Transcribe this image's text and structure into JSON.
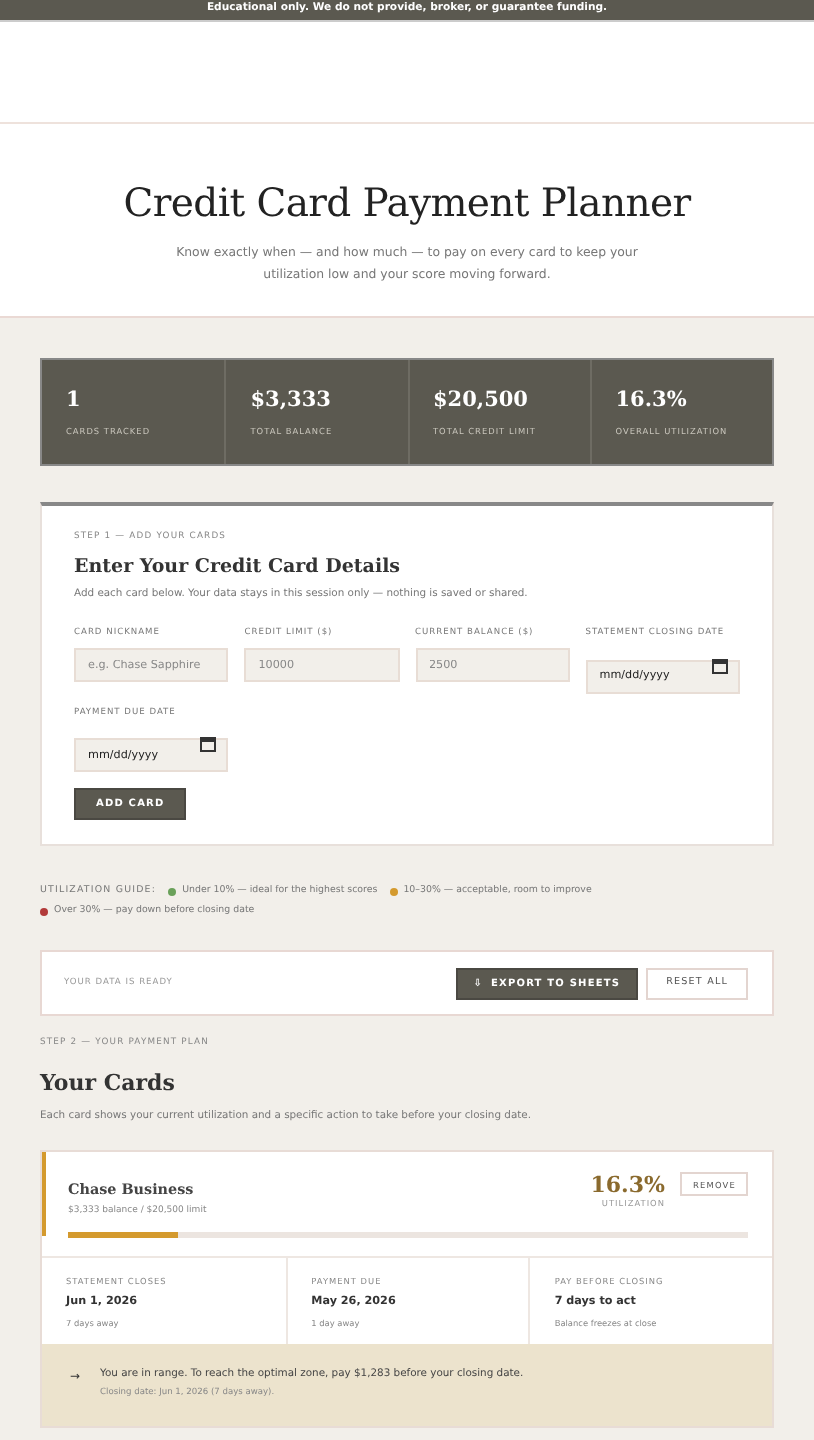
{
  "banner": "Educational only. We do not provide, broker, or guarantee funding.",
  "hero": {
    "title": "Credit Card Payment Planner",
    "subtitle": "Know exactly when — and how much — to pay on every card to keep your utilization low and your score moving forward."
  },
  "stats": [
    {
      "value": "1",
      "label": "CARDS TRACKED"
    },
    {
      "value": "$3,333",
      "label": "TOTAL BALANCE"
    },
    {
      "value": "$20,500",
      "label": "TOTAL CREDIT LIMIT"
    },
    {
      "value": "16.3%",
      "label": "OVERALL UTILIZATION"
    }
  ],
  "form": {
    "step": "STEP 1 — ADD YOUR CARDS",
    "title": "Enter Your Credit Card Details",
    "description": "Add each card below. Your data stays in this session only — nothing is saved or shared.",
    "fields": [
      {
        "kind": "text",
        "label": "CARD NICKNAME",
        "placeholder": "e.g. Chase Sapphire"
      },
      {
        "kind": "text",
        "label": "CREDIT LIMIT ($)",
        "placeholder": "10000"
      },
      {
        "kind": "text",
        "label": "CURRENT BALANCE ($)",
        "placeholder": "2500"
      },
      {
        "kind": "date",
        "label": "STATEMENT CLOSING DATE",
        "placeholder": "mm/dd/yyyy"
      },
      {
        "kind": "date",
        "label": "PAYMENT DUE DATE",
        "placeholder": "mm/dd/yyyy"
      }
    ],
    "button": "ADD CARD"
  },
  "guide": {
    "label": "UTILIZATION GUIDE:",
    "items": [
      {
        "text": "Under 10% — ideal for the highest scores",
        "color": "#6aa15a"
      },
      {
        "text": "10–30% — acceptable, room to improve",
        "color": "#d49a2e"
      },
      {
        "text": "Over 30% — pay down before closing date",
        "color": "#b23a3a"
      }
    ]
  },
  "export_bar": {
    "status": "YOUR DATA IS READY",
    "export_icon": "⇩",
    "export_button": "EXPORT TO SHEETS",
    "reset_button": "RESET ALL"
  },
  "plan": {
    "step": "STEP 2 — YOUR PAYMENT PLAN",
    "title": "Your Cards",
    "description": "Each card shows your current utilization and a specific action to take before your closing date."
  },
  "cards": [
    {
      "name": "Chase Business",
      "summary": "$3,333 balance  /  $20,500 limit",
      "utilization": "16.3%",
      "utilization_label": "UTILIZATION",
      "level": 0.163,
      "color": "#d49a2e",
      "remove": "REMOVE",
      "details": [
        {
          "label": "STATEMENT CLOSES",
          "value": "Jun 1, 2026",
          "note": "7 days away"
        },
        {
          "label": "PAYMENT DUE",
          "value": "May 26, 2026",
          "note": "1 day away"
        },
        {
          "label": "PAY BEFORE CLOSING",
          "value": "7 days to act",
          "note": "Balance freezes at close"
        }
      ],
      "advice_icon": "→",
      "advice": "You are in range. To reach the optimal zone, pay $1,283 before your closing date.",
      "advice_note": "Closing date: Jun 1, 2026 (7 days away)."
    }
  ]
}
